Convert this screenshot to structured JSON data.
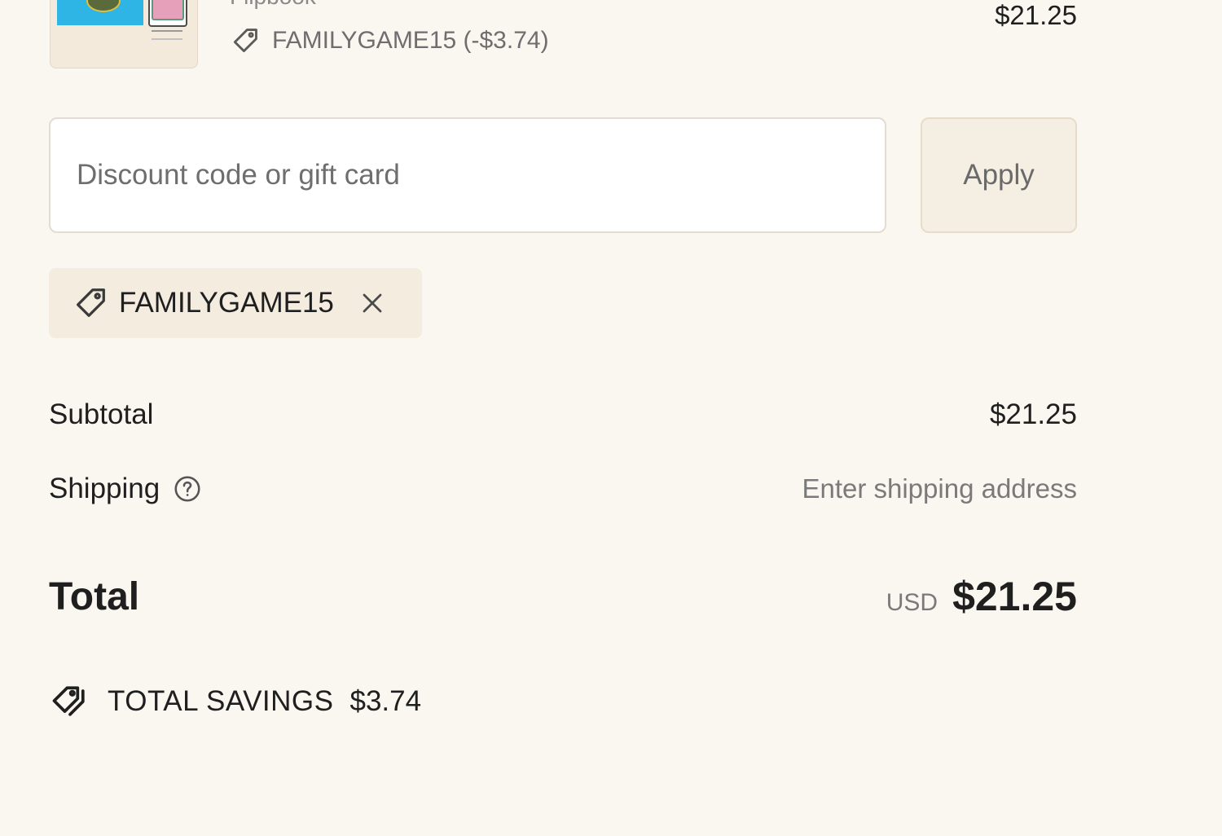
{
  "line_item": {
    "name": "Flipbook",
    "discount": "FAMILYGAME15 (-$3.74)",
    "price": "$21.25",
    "thumbnail_icon": "product-thumbnail"
  },
  "discount_form": {
    "placeholder": "Discount code or gift card",
    "value": "",
    "apply_label": "Apply"
  },
  "applied_code": {
    "code": "FAMILYGAME15",
    "icon": "tag-icon",
    "remove_icon": "close-icon"
  },
  "summary": {
    "subtotal_label": "Subtotal",
    "subtotal_value": "$21.25",
    "shipping_label": "Shipping",
    "shipping_value": "Enter shipping address",
    "total_label": "Total",
    "currency": "USD",
    "total_value": "$21.25"
  },
  "savings": {
    "label": "TOTAL SAVINGS",
    "amount": "$3.74",
    "icon": "tags-icon"
  }
}
